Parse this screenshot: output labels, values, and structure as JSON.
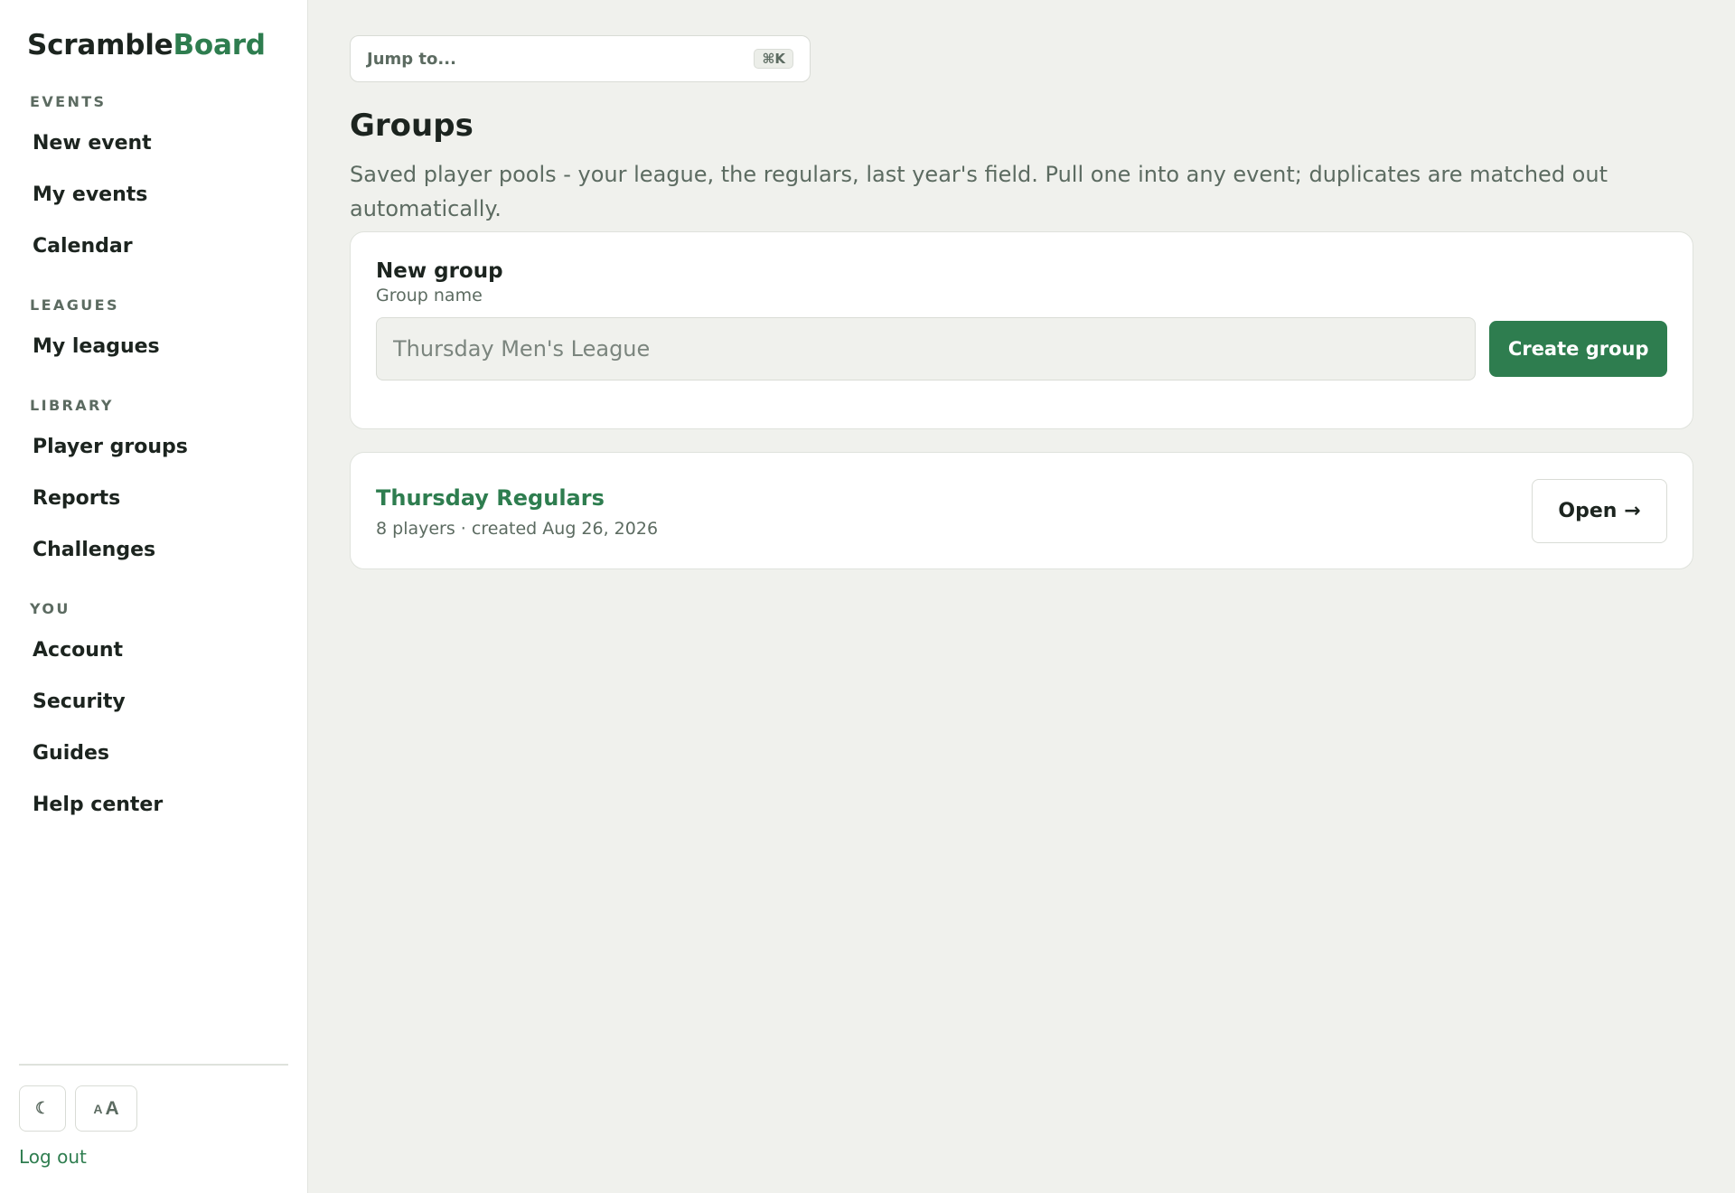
{
  "brand": {
    "part1": "Scramble",
    "part2": "Board"
  },
  "sidebar": {
    "sections": [
      {
        "title": "EVENTS",
        "items": [
          {
            "label": "New event"
          },
          {
            "label": "My events"
          },
          {
            "label": "Calendar"
          }
        ]
      },
      {
        "title": "LEAGUES",
        "items": [
          {
            "label": "My leagues"
          }
        ]
      },
      {
        "title": "LIBRARY",
        "items": [
          {
            "label": "Player groups"
          },
          {
            "label": "Reports"
          },
          {
            "label": "Challenges"
          }
        ]
      },
      {
        "title": "YOU",
        "items": [
          {
            "label": "Account"
          },
          {
            "label": "Security"
          },
          {
            "label": "Guides"
          },
          {
            "label": "Help center"
          }
        ]
      }
    ],
    "footer": {
      "theme_icon": "☾",
      "text_size_small": "A",
      "text_size_big": "A",
      "logout": "Log out"
    }
  },
  "search": {
    "label": "Jump to...",
    "shortcut": "⌘K"
  },
  "page": {
    "title": "Groups",
    "description": "Saved player pools - your league, the regulars, last year's field. Pull one into any event; duplicates are matched out automatically."
  },
  "new_group": {
    "title": "New group",
    "field_label": "Group name",
    "placeholder": "Thursday Men's League",
    "value": "",
    "button": "Create group"
  },
  "groups": [
    {
      "name": "Thursday Regulars",
      "meta": "8 players · created Aug 26, 2026",
      "action": "Open →"
    }
  ],
  "colors": {
    "accent": "#2e7d4f",
    "background": "#f0f1ed",
    "text": "#1c241f",
    "muted": "#5c6b61"
  }
}
